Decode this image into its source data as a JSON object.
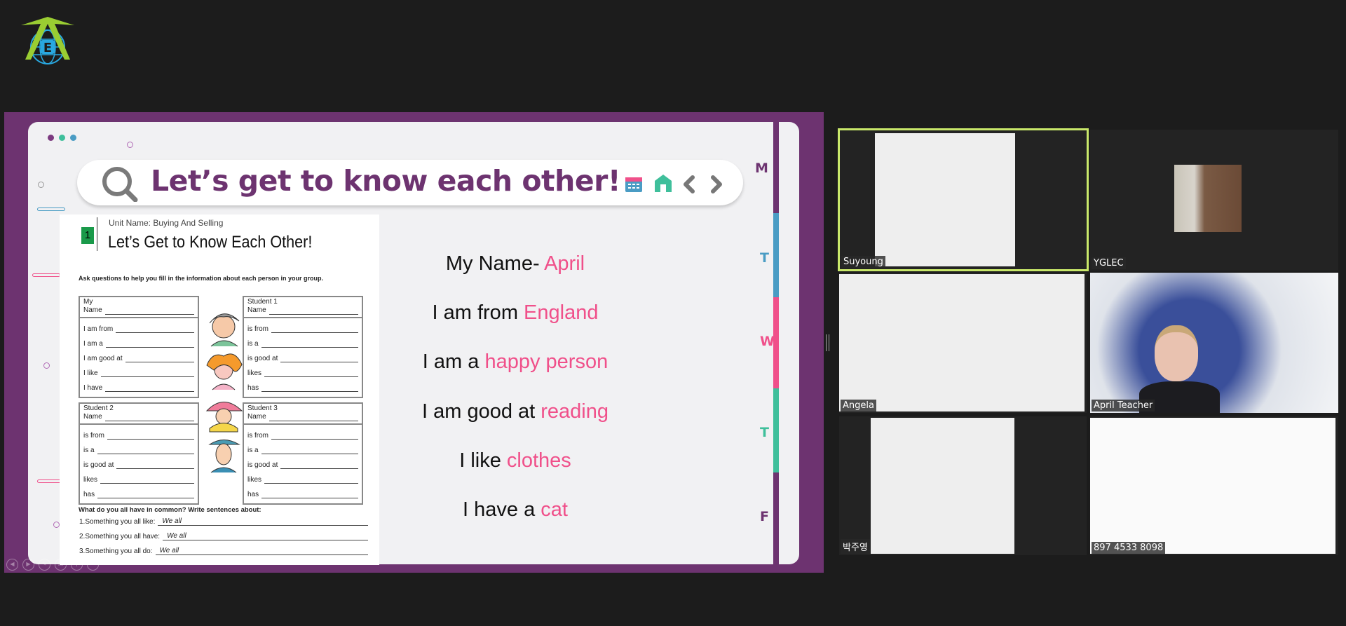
{
  "logo": {
    "letter": "E",
    "colors": {
      "arrow": "#9acd32",
      "globe": "#29a8e0"
    }
  },
  "slide": {
    "title": "Let’s get to know each other!",
    "toolbar_icons": [
      "calendar-icon",
      "home-icon",
      "chevron-left-icon",
      "chevron-right-icon"
    ],
    "day_tabs": [
      {
        "label": "M",
        "color": "#6d3370"
      },
      {
        "label": "T",
        "color": "#4a9cc4"
      },
      {
        "label": "W",
        "color": "#f0508a"
      },
      {
        "label": "T",
        "color": "#3fbf9b"
      },
      {
        "label": "F",
        "color": "#6d3370"
      }
    ],
    "worksheet": {
      "unit": "Unit Name: Buying And Selling",
      "handout_number": "1",
      "heading": "Let’s Get to Know Each Other!",
      "instruction": "Ask questions to help you fill in the information about each person in your group.",
      "boxes": [
        {
          "title": "My",
          "name_label": "Name",
          "lines": [
            "I am from",
            "I am a",
            "I am good at",
            "I like",
            "I have"
          ]
        },
        {
          "title": "Student 1",
          "name_label": "Name",
          "lines": [
            "is from",
            "is a",
            "is good at",
            "likes",
            "has"
          ]
        },
        {
          "title": "Student 2",
          "name_label": "Name",
          "lines": [
            "is from",
            "is a",
            "is good at",
            "likes",
            "has"
          ]
        },
        {
          "title": "Student 3",
          "name_label": "Name",
          "lines": [
            "is from",
            "is a",
            "is good at",
            "likes",
            "has"
          ]
        }
      ],
      "common_heading": "What do you all have in common? Write sentences about:",
      "common": [
        {
          "label": "1.Something you all like:",
          "answer": "We all"
        },
        {
          "label": "2.Something you all have:",
          "answer": "We all"
        },
        {
          "label": "3.Something you all do:",
          "answer": "We all"
        }
      ]
    },
    "sentences": [
      {
        "text": "My Name- ",
        "highlight": "April"
      },
      {
        "text": "I am from ",
        "highlight": "England"
      },
      {
        "text": "I am a ",
        "highlight": "happy person"
      },
      {
        "text": "I am good at ",
        "highlight": "reading"
      },
      {
        "text": "I like ",
        "highlight": "clothes"
      },
      {
        "text": "I have a ",
        "highlight": "cat"
      }
    ],
    "controls": [
      "previous-icon",
      "next-icon",
      "pen-icon",
      "copy-icon",
      "zoom-icon",
      "more-icon"
    ],
    "highlight_color": "#f0508a"
  },
  "participants": [
    {
      "name": "Suyoung",
      "active_speaker": true
    },
    {
      "name": "YGLEC"
    },
    {
      "name": "Angela"
    },
    {
      "name": "April Teacher"
    },
    {
      "name": "박주영"
    },
    {
      "name": "897 4533 8098"
    }
  ]
}
